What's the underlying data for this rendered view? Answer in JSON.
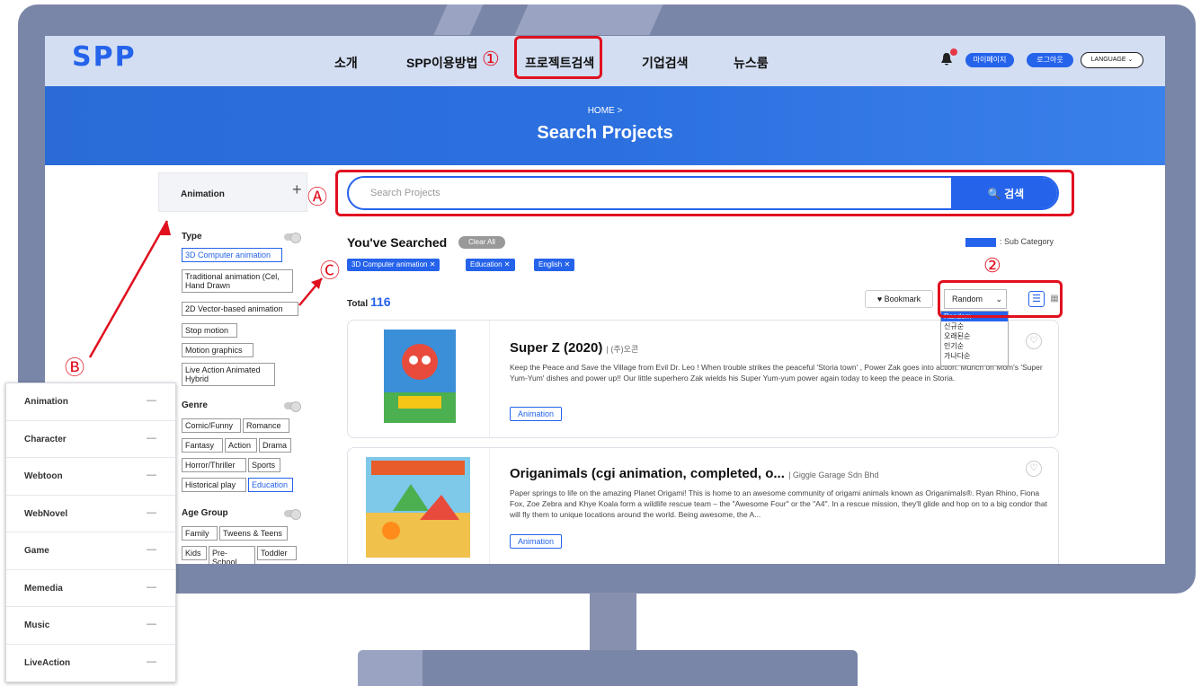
{
  "nav": {
    "logo": "SPP",
    "menu": [
      "소개",
      "SPP이용방법",
      "프로젝트검색",
      "기업검색",
      "뉴스룸"
    ],
    "mypage": "마이페이지",
    "logout": "로그아웃",
    "language": "LANGUAGE"
  },
  "banner": {
    "breadcrumb": "HOME >",
    "title": "Search Projects"
  },
  "sidebar": {
    "category": "Animation",
    "plus": "+",
    "type_title": "Type",
    "type_chips": [
      "3D Computer animation",
      "Traditional animation (Cel, Hand Drawn",
      "2D Vector-based animation",
      "Stop motion",
      "Motion graphics",
      "Live Action Animated Hybrid"
    ],
    "genre_title": "Genre",
    "genre_chips": [
      "Comic/Funny",
      "Romance",
      "Fantasy",
      "Action",
      "Drama",
      "Horror/Thriller",
      "Sports",
      "Historical play",
      "Education"
    ],
    "age_title": "Age Group",
    "age_chips": [
      "Family",
      "Tweens & Teens",
      "Kids",
      "Pre-School",
      "Toddler"
    ]
  },
  "search": {
    "placeholder": "Search Projects",
    "button": "🔍 검색"
  },
  "searched": {
    "title": "You've Searched",
    "clear": "Clear All",
    "sub_category": ": Sub Category",
    "tags": [
      "3D Computer animation ✕",
      "Education ✕",
      "English ✕"
    ]
  },
  "results": {
    "total_label": "Total",
    "total": "116",
    "bookmark": "♥ Bookmark",
    "sort": "Random",
    "sort_options": [
      "Random",
      "신규순",
      "오래된순",
      "인기순",
      "가나다순"
    ]
  },
  "cards": [
    {
      "title": "Super Z (2020)",
      "company": "|  (주)오콘",
      "desc": "Keep the Peace and Save the Village from Evil Dr. Leo ! When trouble strikes the peaceful 'Storia town' , Power Zak goes into action. Munch on Mom's 'Super Yum-Yum' dishes and power up!! Our little superhero Zak wields his Super Yum-yum power again today to keep the peace in Storia.",
      "tag": "Animation"
    },
    {
      "title": "Origanimals (cgi animation, completed, o...",
      "company": "|  Giggle Garage Sdn Bhd",
      "desc": "Paper springs to life on the amazing Planet Origami! This is home to an awesome community of origami animals known as Origanimals®. Ryan Rhino, Fiona Fox, Zoe Zebra and Khye Koala form a wildlife rescue team – the \"Awesome Four\" or the \"A4\". In a rescue mission, they'll glide and hop on to a big condor that will fly them to unique locations around the world. Being awesome, the A...",
      "tag": "Animation"
    }
  ],
  "annotations": {
    "m1": "①",
    "m2": "②",
    "mA": "Ⓐ",
    "mB": "Ⓑ",
    "mC": "Ⓒ"
  },
  "category_panel": [
    "Animation",
    "Character",
    "Webtoon",
    "WebNovel",
    "Game",
    "Memedia",
    "Music",
    "LiveAction"
  ],
  "category_panel_dash": "—",
  "colors": {
    "accent": "#2563eb",
    "highlight": "#e0101f",
    "monitor": "#7a86a8"
  }
}
